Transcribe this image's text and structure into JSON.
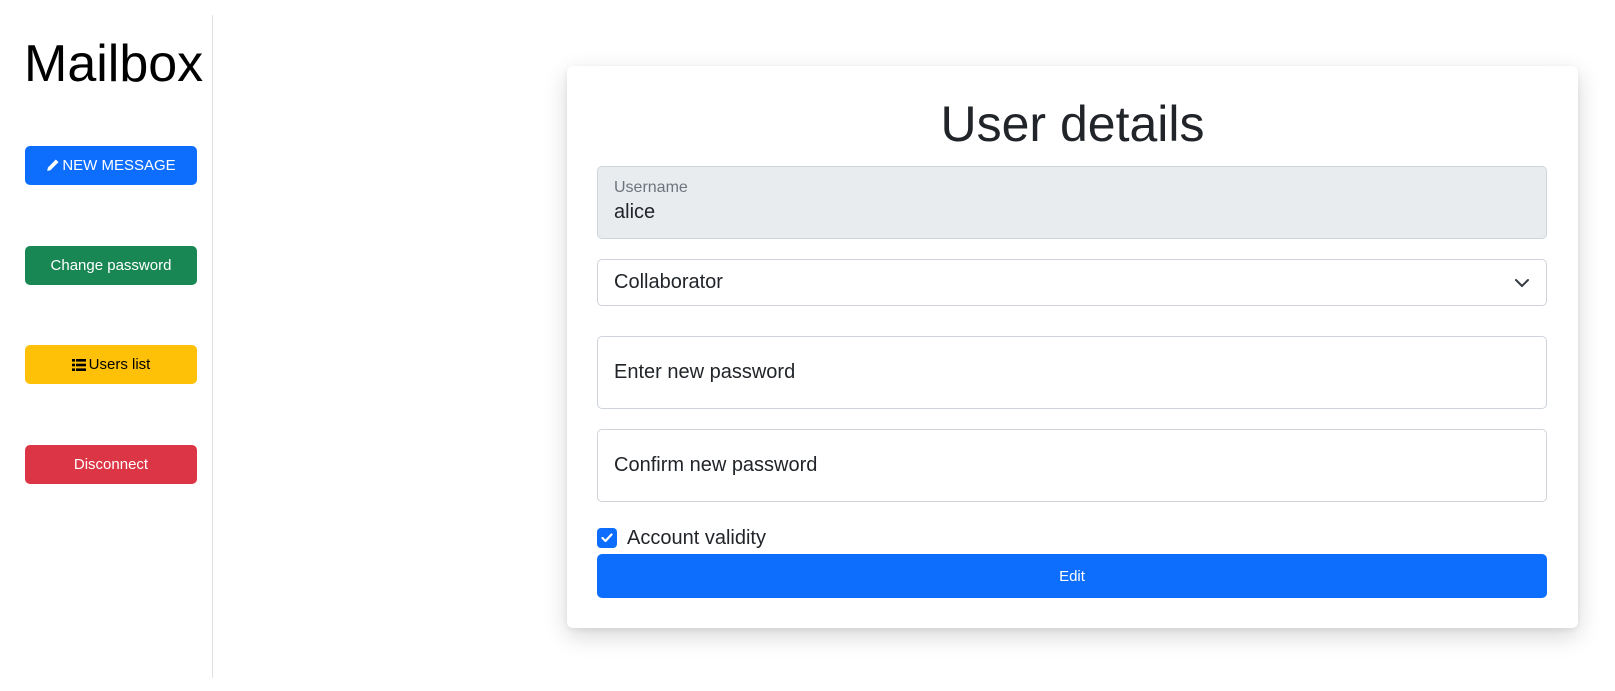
{
  "sidebar": {
    "brand": "Mailbox",
    "buttons": {
      "new_message": {
        "label": "NEW MESSAGE",
        "icon": "pencil-icon",
        "color": "#0d6efd"
      },
      "change_password": {
        "label": "Change password",
        "color": "#198754"
      },
      "users_list": {
        "label": "Users list",
        "icon": "list-icon",
        "color": "#ffc107"
      },
      "disconnect": {
        "label": "Disconnect",
        "color": "#dc3545"
      }
    }
  },
  "form": {
    "title": "User details",
    "username": {
      "label": "Username",
      "value": "alice"
    },
    "role": {
      "selected": "Collaborator",
      "icon": "chevron-down-icon"
    },
    "new_password": {
      "placeholder": "Enter new password"
    },
    "confirm_password": {
      "placeholder": "Confirm new password"
    },
    "account_validity": {
      "label": "Account validity",
      "checked": true
    },
    "submit_label": "Edit",
    "accent_color": "#0d6efd"
  }
}
